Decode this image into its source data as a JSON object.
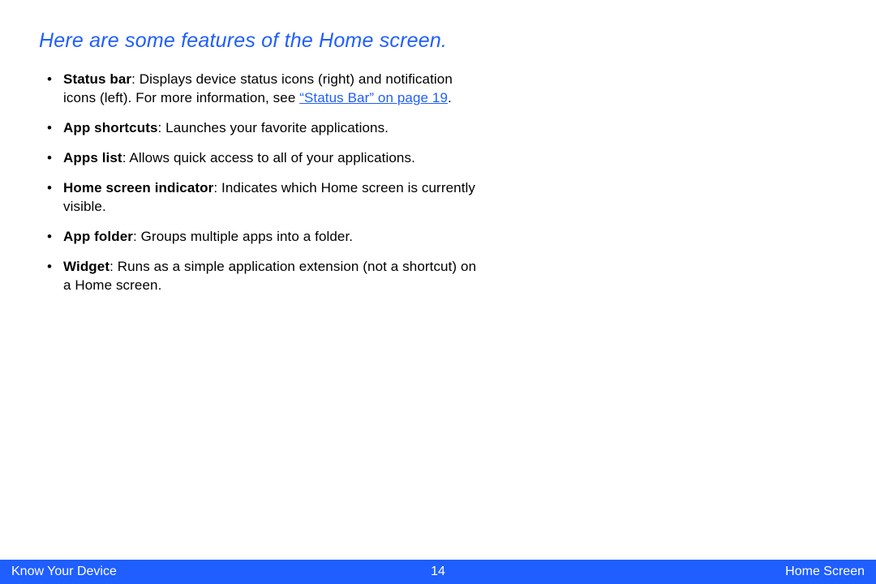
{
  "heading": "Here are some features of the Home screen.",
  "features": [
    {
      "term": "Status bar",
      "desc_before_link": ": Displays device status icons (right) and notification icons (left). For more information, see ",
      "link": "“Status Bar” on page 19",
      "desc_after_link": "."
    },
    {
      "term": "App shortcuts",
      "desc": ": Launches your favorite applications."
    },
    {
      "term": "Apps list",
      "desc": ": Allows quick access to all of your applications."
    },
    {
      "term": "Home screen indicator",
      "desc": ": Indicates which Home screen is currently visible."
    },
    {
      "term": "App folder",
      "desc": ": Groups multiple apps into a folder."
    },
    {
      "term": "Widget",
      "desc": ": Runs as a simple application extension (not a shortcut) on a Home screen."
    }
  ],
  "footer": {
    "left": "Know Your Device",
    "center": "14",
    "right": "Home Screen"
  }
}
